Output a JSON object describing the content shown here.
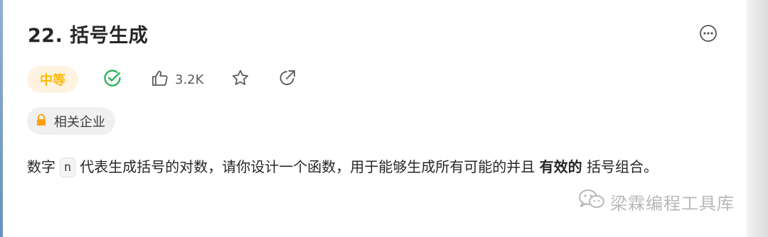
{
  "problem": {
    "title": "22. 括号生成",
    "difficulty": "中等",
    "difficulty_color": "#ffb800",
    "like_count": "3.2K",
    "company_tag": "相关企业",
    "description": {
      "p1": "数字",
      "code": "n",
      "p2": "代表生成括号的对数，请你设计一个函数，用于能够生成所有可能的并且",
      "bold": "有效的",
      "p3": "括号组合。"
    }
  },
  "icons": {
    "more": "more-horizontal-icon",
    "solved": "check-circle-icon",
    "like": "thumbs-up-icon",
    "favorite": "star-icon",
    "share": "share-icon",
    "lock": "lock-icon"
  },
  "watermark": {
    "text": "梁霖编程工具库"
  },
  "colors": {
    "accent_green": "#2db55d",
    "lock_orange": "#ffa116"
  }
}
